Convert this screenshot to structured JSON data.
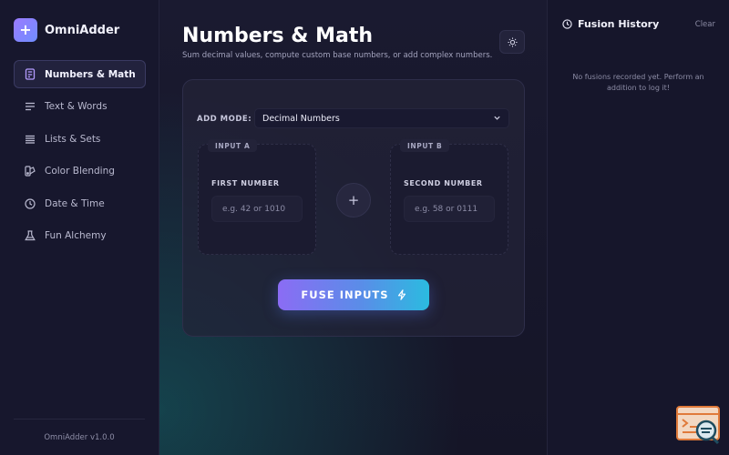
{
  "brand": {
    "name": "OmniAdder",
    "logo_glyph": "+"
  },
  "sidebar": {
    "items": [
      {
        "label": "Numbers & Math",
        "icon": "calculator-icon",
        "active": true
      },
      {
        "label": "Text & Words",
        "icon": "text-lines-icon",
        "active": false
      },
      {
        "label": "Lists & Sets",
        "icon": "list-icon",
        "active": false
      },
      {
        "label": "Color Blending",
        "icon": "palette-icon",
        "active": false
      },
      {
        "label": "Date & Time",
        "icon": "clock-icon",
        "active": false
      },
      {
        "label": "Fun Alchemy",
        "icon": "flask-icon",
        "active": false
      }
    ],
    "footer": "OmniAdder v1.0.0"
  },
  "main": {
    "title": "Numbers & Math",
    "subtitle": "Sum decimal values, compute custom base numbers, or add complex numbers.",
    "theme_icon": "sun-icon",
    "add_mode_label": "ADD MODE:",
    "add_mode_value": "Decimal Numbers",
    "input_a": {
      "tag": "INPUT A",
      "label": "FIRST NUMBER",
      "placeholder": "e.g. 42 or 1010",
      "value": ""
    },
    "input_b": {
      "tag": "INPUT B",
      "label": "SECOND NUMBER",
      "placeholder": "e.g. 58 or 0111",
      "value": ""
    },
    "plus_glyph": "+",
    "fuse_label": "FUSE INPUTS"
  },
  "history": {
    "title": "Fusion History",
    "clear_label": "Clear",
    "empty_text": "No fusions recorded yet. Perform an addition to log it!"
  },
  "colors": {
    "accent_purple": "#8b6cf4",
    "accent_cyan": "#2bbbe0",
    "background": "#14142a"
  }
}
